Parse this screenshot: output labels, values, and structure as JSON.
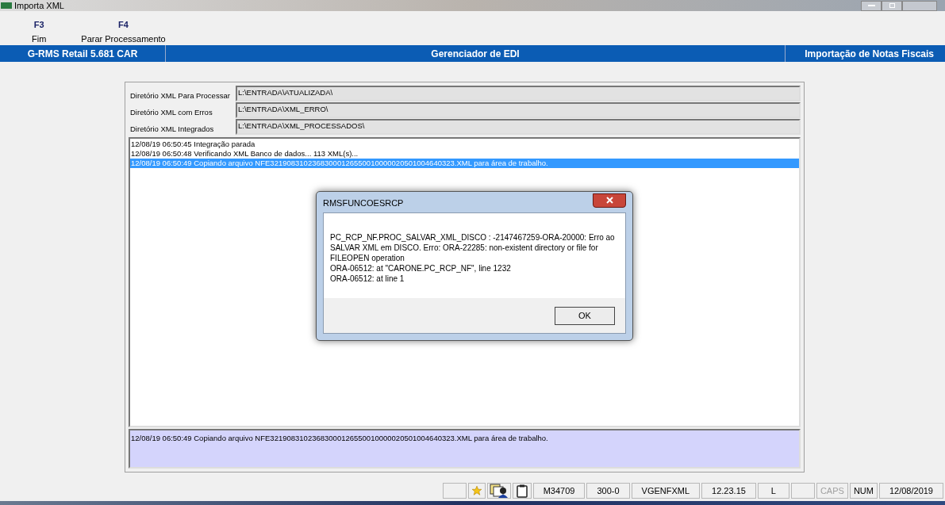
{
  "window": {
    "title": "Importa XML"
  },
  "toolbar": [
    {
      "key": "F3",
      "label": "Fim"
    },
    {
      "key": "F4",
      "label": "Parar Processamento"
    }
  ],
  "header": {
    "left": "G-RMS Retail 5.681 CAR",
    "center": "Gerenciador de EDI",
    "right": "Importação de Notas Fiscais"
  },
  "fields": [
    {
      "label": "Diretório XML Para Processar",
      "value": "L:\\ENTRADA\\ATUALIZADA\\"
    },
    {
      "label": "Diretório XML com Erros",
      "value": "L:\\ENTRADA\\XML_ERRO\\"
    },
    {
      "label": "Diretório XML Integrados",
      "value": "L:\\ENTRADA\\XML_PROCESSADOS\\"
    }
  ],
  "log": [
    {
      "text": "12/08/19 06:50:45 Integração parada",
      "selected": false
    },
    {
      "text": "12/08/19 06:50:48 Verificando XML Banco de dados... 113 XML(s)...",
      "selected": false
    },
    {
      "text": "12/08/19 06:50:49 Copiando arquivo NFE32190831023683000126550010000020501004640323.XML para área de trabalho.",
      "selected": true
    }
  ],
  "detail": "12/08/19 06:50:49 Copiando arquivo NFE32190831023683000126550010000020501004640323.XML para área de trabalho.",
  "dialog": {
    "title": "RMSFUNCOESRCP",
    "lines": [
      "PC_RCP_NF.PROC_SALVAR_XML_DISCO : -2147467259-ORA-20000: Erro ao SALVAR XML em DISCO. Erro: ORA-22285: non-existent directory or file for FILEOPEN operation",
      "ORA-06512: at \"CARONE.PC_RCP_NF\", line 1232",
      "ORA-06512: at line 1"
    ],
    "button": "OK"
  },
  "status_bar": [
    {
      "kind": "blank"
    },
    {
      "kind": "star"
    },
    {
      "kind": "users"
    },
    {
      "kind": "clipboard"
    },
    {
      "kind": "text",
      "text": "M34709"
    },
    {
      "kind": "text",
      "text": "300-0"
    },
    {
      "kind": "text",
      "text": "VGENFXML"
    },
    {
      "kind": "text",
      "text": "12.23.15"
    },
    {
      "kind": "text",
      "text": "L"
    },
    {
      "kind": "blank"
    },
    {
      "kind": "indicator",
      "text": "CAPS",
      "on": false
    },
    {
      "kind": "indicator",
      "text": "NUM",
      "on": true
    },
    {
      "kind": "text",
      "text": "12/08/2019"
    }
  ]
}
